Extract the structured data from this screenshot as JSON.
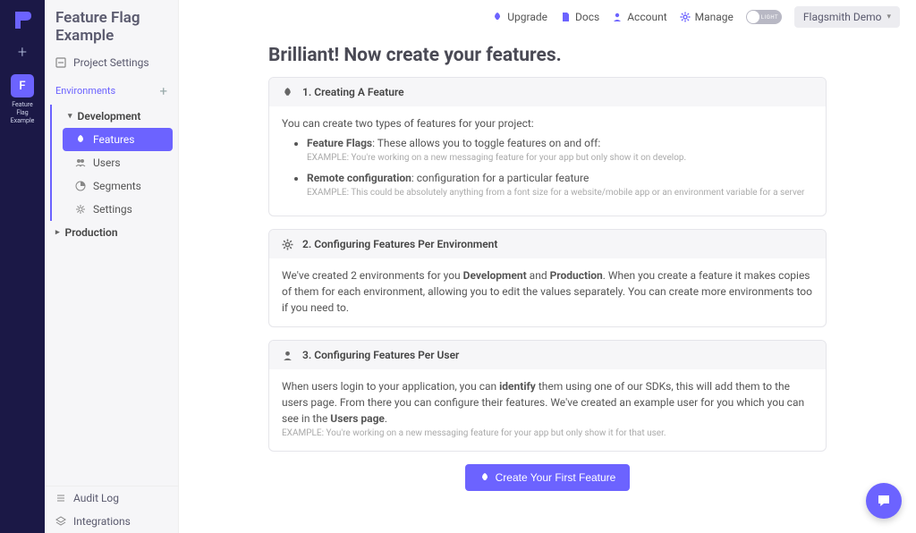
{
  "colors": {
    "accent": "#6c63ff",
    "railBg": "#1b1846",
    "sidebarBg": "#f6f6f8"
  },
  "rail": {
    "project_initial": "F",
    "project_label": "Feature Flag Example"
  },
  "sidebar": {
    "title": "Feature Flag Example",
    "project_settings": "Project Settings",
    "env_header": "Environments",
    "envs": {
      "dev": {
        "name": "Development",
        "expanded": true
      },
      "prod": {
        "name": "Production",
        "expanded": false
      }
    },
    "items": {
      "features": "Features",
      "users": "Users",
      "segments": "Segments",
      "settings": "Settings"
    },
    "bottom": {
      "audit": "Audit Log",
      "integrations": "Integrations"
    }
  },
  "topbar": {
    "upgrade": "Upgrade",
    "docs": "Docs",
    "account": "Account",
    "manage": "Manage",
    "theme_label": "LIGHT",
    "org": "Flagsmith Demo"
  },
  "main": {
    "heading": "Brilliant! Now create your features.",
    "card1": {
      "title": "1. Creating A Feature",
      "intro": "You can create two types of features for your project:",
      "b1_strong": "Feature Flags",
      "b1_rest": ": These allows you to toggle features on and off:",
      "b1_ex": "EXAMPLE: You're working on a new messaging feature for your app but only show it on develop.",
      "b2_strong": "Remote configuration",
      "b2_rest": ": configuration for a particular feature",
      "b2_ex": "EXAMPLE: This could be absolutely anything from a font size for a website/mobile app or an environment variable for a server"
    },
    "card2": {
      "title": "2. Configuring Features Per Environment",
      "p_a": "We've created 2 environments for you ",
      "p_dev": "Development",
      "p_and": " and ",
      "p_prod": "Production",
      "p_b": ". When you create a feature it makes copies of them for each environment, allowing you to edit the values separately. You can create more environments too if you need to."
    },
    "card3": {
      "title": "3. Configuring Features Per User",
      "p_a": "When users login to your application, you can ",
      "p_identify": "identify",
      "p_b": " them using one of our SDKs, this will add them to the users page. From there you can configure their features. We've created an example user for you which you can see in the ",
      "p_users": "Users page",
      "p_c": ".",
      "ex": "EXAMPLE: You're working on a new messaging feature for your app but only show it for that user."
    },
    "cta": "Create Your First Feature"
  }
}
